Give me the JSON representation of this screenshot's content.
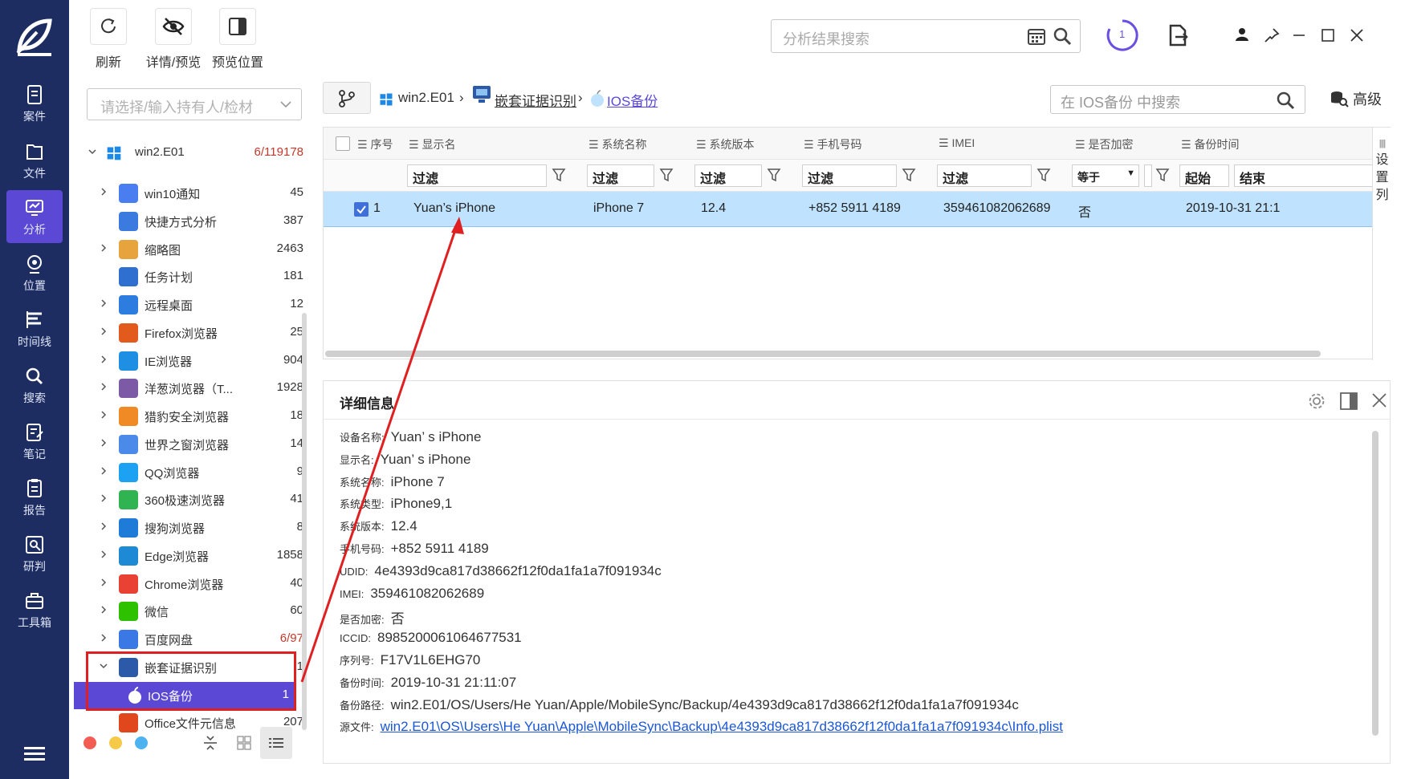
{
  "nav": [
    {
      "label": "案件",
      "icon": "case-icon"
    },
    {
      "label": "文件",
      "icon": "file-icon"
    },
    {
      "label": "分析",
      "icon": "analysis-icon"
    },
    {
      "label": "位置",
      "icon": "location-icon"
    },
    {
      "label": "时间线",
      "icon": "timeline-icon"
    },
    {
      "label": "搜索",
      "icon": "search-icon"
    },
    {
      "label": "笔记",
      "icon": "note-icon"
    },
    {
      "label": "报告",
      "icon": "report-icon"
    },
    {
      "label": "研判",
      "icon": "judge-icon"
    },
    {
      "label": "工具箱",
      "icon": "toolbox-icon"
    }
  ],
  "toolbar": {
    "refresh": "刷新",
    "detail_preview": "详情/预览",
    "preview_position": "预览位置",
    "search_placeholder": "分析结果搜索",
    "task_count": "1"
  },
  "tree": {
    "owner_placeholder": "请选择/输入持有人/检材",
    "root": {
      "name": "win2.E01",
      "count": "6/119178"
    },
    "items": [
      {
        "name": "win10通知",
        "count": "45",
        "color": "#4a7ef0"
      },
      {
        "name": "快捷方式分析",
        "count": "387",
        "color": "#3b7be0"
      },
      {
        "name": "缩略图",
        "count": "2463",
        "color": "#e7a43d"
      },
      {
        "name": "任务计划",
        "count": "181",
        "color": "#2f6fd0"
      },
      {
        "name": "远程桌面",
        "count": "12",
        "color": "#2d7de0"
      },
      {
        "name": "Firefox浏览器",
        "count": "25",
        "color": "#e25b1c"
      },
      {
        "name": "IE浏览器",
        "count": "904",
        "color": "#1f8fe3"
      },
      {
        "name": "洋葱浏览器（T...",
        "count": "1928",
        "color": "#7c5aa6"
      },
      {
        "name": "猎豹安全浏览器",
        "count": "18",
        "color": "#f08a24"
      },
      {
        "name": "世界之窗浏览器",
        "count": "14",
        "color": "#4b8ae8"
      },
      {
        "name": "QQ浏览器",
        "count": "9",
        "color": "#1da1f2"
      },
      {
        "name": "360极速浏览器",
        "count": "41",
        "color": "#2fb451"
      },
      {
        "name": "搜狗浏览器",
        "count": "8",
        "color": "#1e7bd8"
      },
      {
        "name": "Edge浏览器",
        "count": "1858",
        "color": "#1e8ad6"
      },
      {
        "name": "Chrome浏览器",
        "count": "40",
        "color": "#e94235"
      },
      {
        "name": "微信",
        "count": "60",
        "color": "#2dc100"
      },
      {
        "name": "百度网盘",
        "count": "6/97",
        "color": "#3a78e6"
      },
      {
        "name": "嵌套证据识别",
        "count": "1",
        "color": "#2c5aa8"
      },
      {
        "name": "IOS备份",
        "count": "1",
        "color": "#ffffff"
      },
      {
        "name": "Office文件元信息",
        "count": "207",
        "color": "#e0471c"
      }
    ]
  },
  "breadcrumb": {
    "root": "win2.E01",
    "level1": "嵌套证据识别",
    "level2": "IOS备份",
    "search_placeholder": "在 IOS备份 中搜索",
    "advanced": "高级"
  },
  "table": {
    "columns": [
      "序号",
      "显示名",
      "系统名称",
      "系统版本",
      "手机号码",
      "IMEI",
      "是否加密",
      "备份时间"
    ],
    "filter_label": "过滤",
    "filter_equals": "等于",
    "filter_start": "起始",
    "filter_end": "结束",
    "column_settings": "设置列",
    "rows": [
      {
        "index": "1",
        "display_name": "Yuan’s iPhone",
        "system_name": "iPhone 7",
        "version": "12.4",
        "phone": "+852 5911 4189",
        "imei": "359461082062689",
        "encrypted": "否",
        "backup_time": "2019-10-31 21:1"
      }
    ]
  },
  "detail": {
    "title": "详细信息",
    "fields": [
      {
        "k": "设备名称:",
        "v": "Yuan’ s iPhone"
      },
      {
        "k": "显示名:",
        "v": "Yuan’ s iPhone"
      },
      {
        "k": "系统名称:",
        "v": "iPhone 7"
      },
      {
        "k": "系统类型:",
        "v": "iPhone9,1"
      },
      {
        "k": "系统版本:",
        "v": "12.4"
      },
      {
        "k": "手机号码:",
        "v": "+852 5911 4189"
      },
      {
        "k": "UDID:",
        "v": "4e4393d9ca817d38662f12f0da1fa1a7f091934c"
      },
      {
        "k": "IMEI:",
        "v": "359461082062689"
      },
      {
        "k": "是否加密:",
        "v": "否"
      },
      {
        "k": "ICCID:",
        "v": "8985200061064677531"
      },
      {
        "k": "序列号:",
        "v": "F17V1L6EHG70"
      },
      {
        "k": "备份时间:",
        "v": "2019-10-31 21:11:07"
      },
      {
        "k": "备份路径:",
        "v": "win2.E01/OS/Users/He Yuan/Apple/MobileSync/Backup/4e4393d9ca817d38662f12f0da1fa1a7f091934c"
      },
      {
        "k": "源文件:",
        "v": "win2.E01\\OS\\Users\\He Yuan\\Apple\\MobileSync\\Backup\\4e4393d9ca817d38662f12f0da1fa1a7f091934c\\Info.plist"
      }
    ]
  },
  "colors": {
    "nav_bg": "#1d2d62",
    "accent": "#5b49d6",
    "row_selected": "#bfe3ff",
    "annotation_red": "#e02020"
  }
}
